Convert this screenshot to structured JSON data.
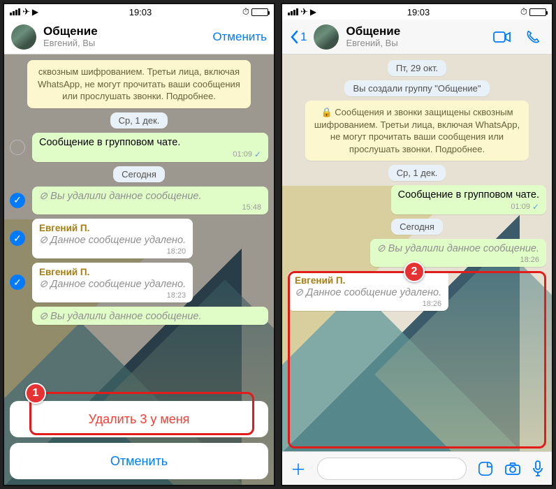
{
  "time": "19:03",
  "cancel": "Отменить",
  "chat": {
    "name": "Общение",
    "sub": "Евгений, Вы",
    "back_num": "1"
  },
  "notice_text": "Сообщения и звонки защищены сквозным шифрованием. Третьи лица, включая WhatsApp, не могут прочитать ваши сообщения или прослушать звонки. Подробнее.",
  "notice_text_short": "сквозным шифрованием. Третьи лица, включая WhatsApp, не могут прочитать ваши сообщения или прослушать звонки. Подробнее.",
  "date_fri": "Пт, 29 окт.",
  "group_created": "Вы создали группу \"Общение\"",
  "date_wed": "Ср, 1 дек.",
  "date_today": "Сегодня",
  "sender_name": "Евгений П.",
  "msg_group": "Сообщение в групповом чате.",
  "msg_deleted_out": "⊘ Вы удалили данное сообщение.",
  "msg_deleted_in": "⊘ Данное сообщение удалено.",
  "times": {
    "t1": "01:09",
    "t2": "15:48",
    "t3": "18:20",
    "t4": "18:23",
    "t5": "18:26"
  },
  "sheet": {
    "delete": "Удалить 3 у меня",
    "cancel": "Отменить"
  },
  "badge1": "1",
  "badge2": "2"
}
